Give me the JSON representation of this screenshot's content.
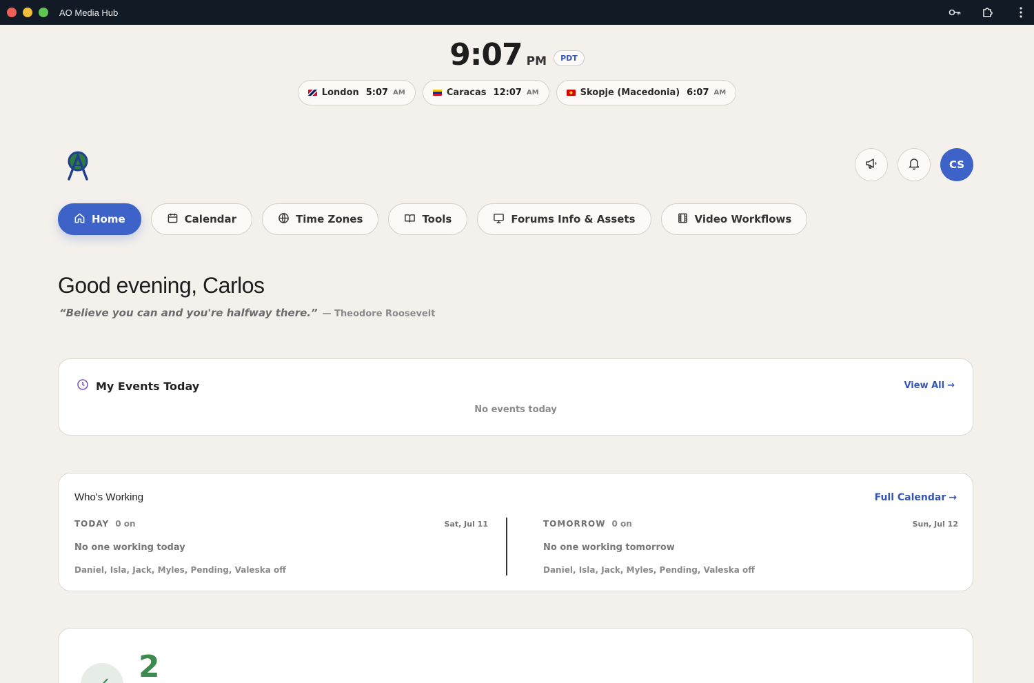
{
  "window": {
    "title": "AO Media Hub"
  },
  "clock": {
    "time": "9:07",
    "ampm": "PM",
    "tz": "PDT"
  },
  "world_clocks": [
    {
      "city": "London",
      "time": "5:07",
      "ampm": "AM"
    },
    {
      "city": "Caracas",
      "time": "12:07",
      "ampm": "AM"
    },
    {
      "city": "Skopje (Macedonia)",
      "time": "6:07",
      "ampm": "AM"
    }
  ],
  "user": {
    "initials": "CS"
  },
  "nav": [
    {
      "label": "Home",
      "icon": "home-icon"
    },
    {
      "label": "Calendar",
      "icon": "calendar-icon"
    },
    {
      "label": "Time Zones",
      "icon": "globe-icon"
    },
    {
      "label": "Tools",
      "icon": "book-icon"
    },
    {
      "label": "Forums Info & Assets",
      "icon": "presentation-icon"
    },
    {
      "label": "Video Workflows",
      "icon": "film-icon"
    }
  ],
  "greeting": "Good evening, Carlos",
  "quote": {
    "text": "“Believe you can and you're halfway there.”",
    "author": "— Theodore Roosevelt"
  },
  "events_card": {
    "title": "My Events Today",
    "view_all": "View All",
    "empty": "No events today"
  },
  "working_card": {
    "title": "Who's Working",
    "full_calendar": "Full Calendar",
    "today": {
      "label": "TODAY",
      "count": "0 on",
      "date": "Sat, Jul 11",
      "status": "No one working today",
      "off": "Daniel, Isla, Jack, Myles, Pending, Valeska off"
    },
    "tomorrow": {
      "label": "TOMORROW",
      "count": "0 on",
      "date": "Sun, Jul 12",
      "status": "No one working tomorrow",
      "off": "Daniel, Isla, Jack, Myles, Pending, Valeska off"
    }
  },
  "stat_card": {
    "value": "2"
  },
  "colors": {
    "accent": "#3d63c9",
    "link": "#3656b5",
    "background": "#f4f1ec",
    "titlebar": "#121a26",
    "success": "#3c8a4e"
  }
}
